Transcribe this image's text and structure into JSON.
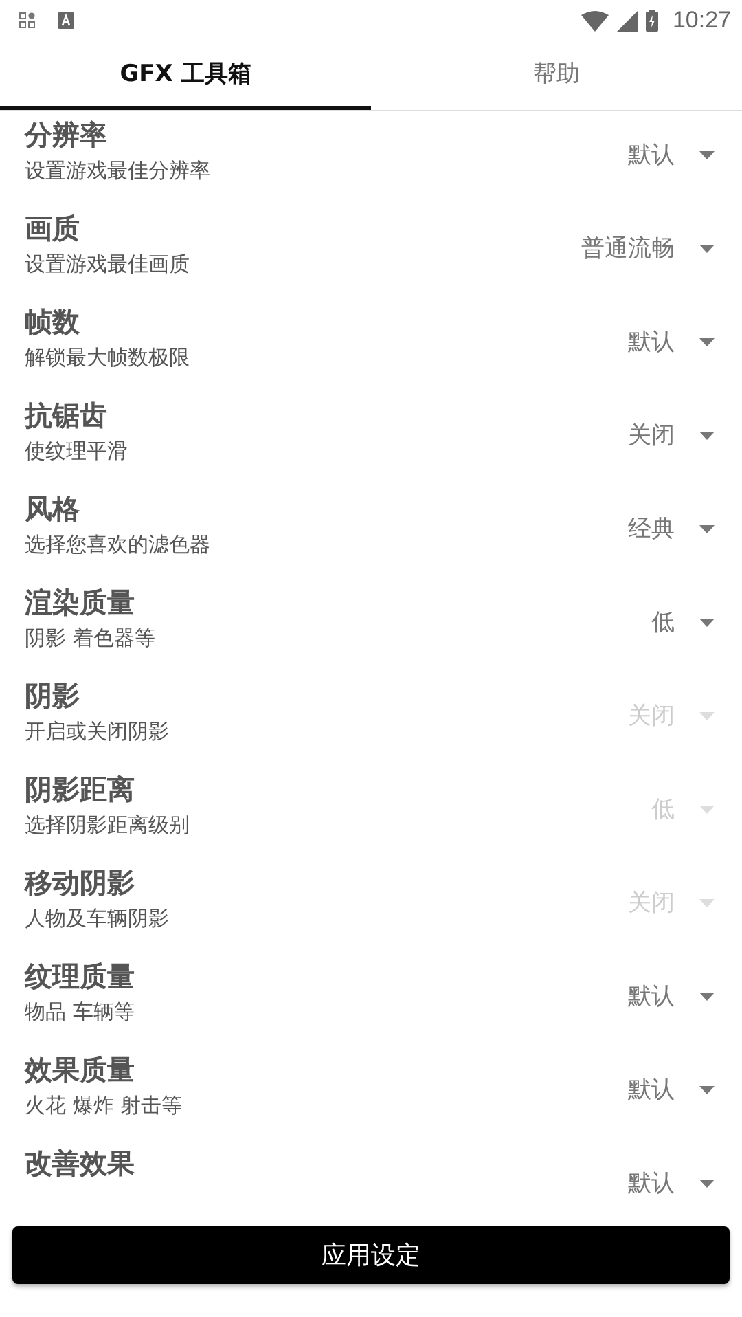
{
  "status_bar": {
    "time": "10:27"
  },
  "tabs": [
    {
      "label": "GFX 工具箱",
      "selected": true
    },
    {
      "label": "帮助",
      "selected": false
    }
  ],
  "settings": [
    {
      "title": "分辨率",
      "subtitle": "设置游戏最佳分辨率",
      "value": "默认",
      "disabled": false
    },
    {
      "title": "画质",
      "subtitle": "设置游戏最佳画质",
      "value": "普通流畅",
      "disabled": false
    },
    {
      "title": "帧数",
      "subtitle": "解锁最大帧数极限",
      "value": "默认",
      "disabled": false
    },
    {
      "title": "抗锯齿",
      "subtitle": "使纹理平滑",
      "value": "关闭",
      "disabled": false
    },
    {
      "title": "风格",
      "subtitle": "选择您喜欢的滤色器",
      "value": "经典",
      "disabled": false
    },
    {
      "title": "渲染质量",
      "subtitle": "阴影 着色器等",
      "value": "低",
      "disabled": false
    },
    {
      "title": "阴影",
      "subtitle": "开启或关闭阴影",
      "value": "关闭",
      "disabled": true
    },
    {
      "title": "阴影距离",
      "subtitle": "选择阴影距离级别",
      "value": "低",
      "disabled": true
    },
    {
      "title": "移动阴影",
      "subtitle": "人物及车辆阴影",
      "value": "关闭",
      "disabled": true
    },
    {
      "title": "纹理质量",
      "subtitle": "物品 车辆等",
      "value": "默认",
      "disabled": false
    },
    {
      "title": "效果质量",
      "subtitle": "火花 爆炸 射击等",
      "value": "默认",
      "disabled": false
    },
    {
      "title": "改善效果",
      "value": "默认",
      "disabled": false
    }
  ],
  "apply_button": "应用设定"
}
